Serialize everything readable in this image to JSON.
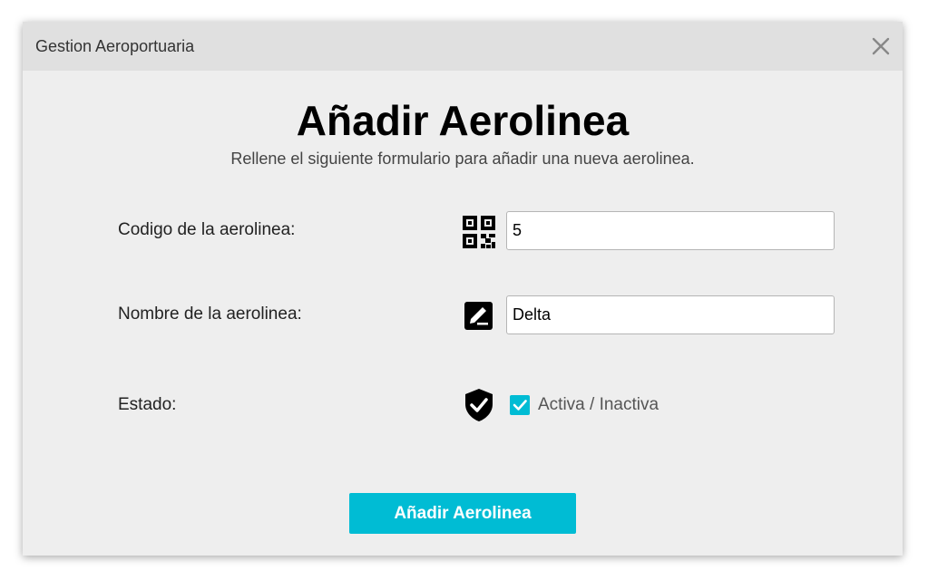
{
  "window": {
    "title": "Gestion Aeroportuaria",
    "close_icon": "close-icon"
  },
  "form": {
    "heading": "Añadir Aerolinea",
    "subheading": "Rellene el siguiente formulario para añadir una nueva aerolinea.",
    "code": {
      "label": "Codigo de la aerolinea:",
      "icon": "qr-code-icon",
      "value": "5"
    },
    "name": {
      "label": "Nombre de la aerolinea:",
      "icon": "edit-icon",
      "value": "Delta"
    },
    "status": {
      "label": "Estado:",
      "icon": "shield-check-icon",
      "checkbox_label": "Activa / Inactiva",
      "checked": true
    },
    "submit_label": "Añadir Aerolinea"
  },
  "colors": {
    "accent": "#00bcd4",
    "dialog_background": "#eeeeee",
    "titlebar_background": "#e0e0e0"
  }
}
